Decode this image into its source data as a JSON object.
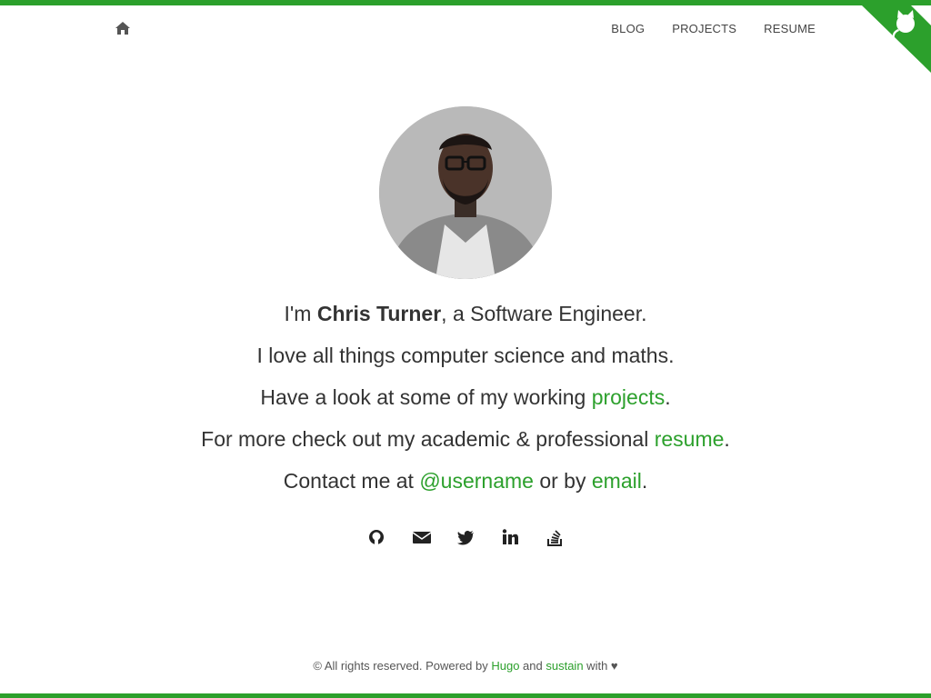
{
  "nav": {
    "home_icon": "home-icon",
    "items": [
      {
        "label": "BLOG"
      },
      {
        "label": "PROJECTS"
      },
      {
        "label": "RESUME"
      }
    ],
    "corner_icon": "github-cat-icon"
  },
  "profile": {
    "photo": "profile-photo"
  },
  "intro": {
    "line1_pre": "I'm ",
    "name": "Chris Turner",
    "line1_post": ", a Software Engineer.",
    "line2": "I love all things computer science and maths.",
    "line3_pre": "Have a look at some of my working ",
    "projects_link": "projects",
    "line3_post": ".",
    "line4_pre": "For more check out my academic & professional ",
    "resume_link": "resume",
    "line4_post": ".",
    "line5_pre": "Contact me at ",
    "username_link": "@username",
    "line5_mid": " or by ",
    "email_link": "email",
    "line5_post": "."
  },
  "social": [
    "github-icon",
    "envelope-icon",
    "twitter-icon",
    "linkedin-icon",
    "stackoverflow-icon"
  ],
  "footer": {
    "pre": "© All rights reserved. Powered by ",
    "hugo_link": "Hugo",
    "and": " and ",
    "sustain_link": "sustain",
    "post": " with ♥"
  },
  "colors": {
    "accent": "#2ca02c",
    "text": "#333333"
  }
}
